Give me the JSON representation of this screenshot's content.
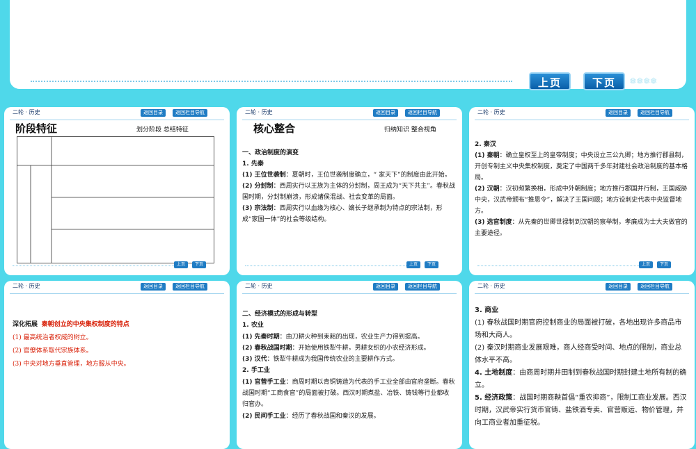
{
  "nav": {
    "prev": "上页",
    "next": "下页",
    "flakes": "❅❅❅❅"
  },
  "common": {
    "crumb": "二轮 · 历史",
    "btn1": "返回目录",
    "btn2": "返回栏目导航",
    "mini_prev": "上页",
    "mini_next": "下页"
  },
  "s1": {
    "title": "阶段特征",
    "sub": "划分阶段   总结特征"
  },
  "s2": {
    "title": "核心整合",
    "sub": "归纳知识   整合视角",
    "lines": [
      {
        "b": "一、政治制度的演变",
        "t": ""
      },
      {
        "b": "1. 先秦",
        "t": ""
      },
      {
        "b": "(1) 王位世袭制",
        "t": "：夏朝时，王位世袭制度确立，“ 家天下”的制度由此开始。"
      },
      {
        "b": "(2) 分封制",
        "t": "：西周实行以王族为主体的分封制，周王成为“天下共主”。春秋战国时期，分封制崩溃，形成诸侯混战、社会变革的局面。"
      },
      {
        "b": "(3) 宗法制",
        "t": "：西周实行以血缘为核心、嫡长子继承制为特点的宗法制，形成“家国一体”的社会等级结构。"
      }
    ]
  },
  "s3": {
    "lines": [
      {
        "b": "2. 秦汉",
        "t": ""
      },
      {
        "b": "(1) 秦朝",
        "t": "：确立皇权至上的皇帝制度；中央设立三公九卿；地方推行郡县制，开创专制主义中央集权制度，奠定了中国两千多年封建社会政治制度的基本格局。"
      },
      {
        "b": "(2) 汉朝",
        "t": "：汉初频繁换相，形成中外朝制度；地方推行郡国并行制，王国威胁中央，汉武帝颁布“推恩令”，解决了王国问题；地方设刺史代表中央监督地方。"
      },
      {
        "b": "(3) 选官制度",
        "t": "：从先秦的世卿世禄制到汉朝的察举制，孝廉成为士大夫做官的主要途径。"
      }
    ]
  },
  "s4": {
    "head": "深化拓展",
    "head2": "秦朝创立的中央集权制度的特点",
    "items": [
      "(1) 最高统治者权威的树立。",
      "(2) 官僚体系取代宗族体系。",
      "(3) 中央对地方垂直管理，地方服从中央。"
    ]
  },
  "s5": {
    "lines": [
      {
        "b": "二、经济模式的形成与转型",
        "t": ""
      },
      {
        "b": "1. 农业",
        "t": ""
      },
      {
        "b": "(1) 先秦时期",
        "t": "：由刀耕火种到耒耜的出现，农业生产力得到提高。"
      },
      {
        "b": "(2) 春秋战国时期",
        "t": "：开始使用铁犁牛耕，男耕女织的小农经济形成。"
      },
      {
        "b": "(3) 汉代",
        "t": "：铁犁牛耕成为我国传统农业的主要耕作方式。"
      },
      {
        "b": "2. 手工业",
        "t": ""
      },
      {
        "b": "(1) 官营手工业",
        "t": "：商周时期以青铜铸造为代表的手工业全部由官府垄断。春秋战国时期“工商食官”的局面被打破。西汉时期煮盐、冶铁、铸钱等行业都收归官办。"
      },
      {
        "b": "(2) 民间手工业",
        "t": "：经历了春秋战国和秦汉的发展。"
      }
    ]
  },
  "s6": {
    "lines": [
      {
        "b": "3. 商业",
        "t": ""
      },
      {
        "b": "",
        "t": "(1) 春秋战国时期官府控制商业的局面被打破，各地出现许多商品市场和大商人。"
      },
      {
        "b": "",
        "t": "(2) 秦汉时期商业发展艰难，商人经商受时间、地点的限制，商业总体水平不高。"
      },
      {
        "b": "4. 土地制度",
        "t": "：由商周时期井田制到春秋战国时期封建土地所有制的确立。"
      },
      {
        "b": "5. 经济政策",
        "t": "：战国时期商鞅首倡“重农抑商”，限制工商业发展。西汉时期，汉武帝实行货币官铸、盐铁酒专卖、官营贩运、物价管理，并向工商业者加重征税。"
      }
    ]
  },
  "colors": {
    "bg": "#4fd8ea",
    "button": "#1f7cc4",
    "red": "#d81e06"
  }
}
